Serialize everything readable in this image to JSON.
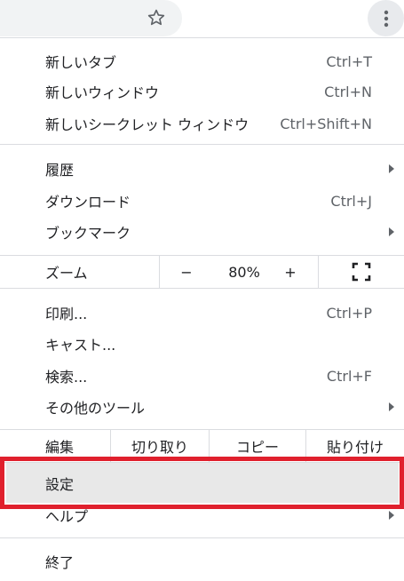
{
  "toolbar": {
    "star_icon": "star-outline-icon",
    "menu_icon": "three-dots-vertical-icon"
  },
  "menu": {
    "new_tab": {
      "label": "新しいタブ",
      "shortcut": "Ctrl+T"
    },
    "new_window": {
      "label": "新しいウィンドウ",
      "shortcut": "Ctrl+N"
    },
    "new_incognito": {
      "label": "新しいシークレット ウィンドウ",
      "shortcut": "Ctrl+Shift+N"
    },
    "history": {
      "label": "履歴"
    },
    "downloads": {
      "label": "ダウンロード",
      "shortcut": "Ctrl+J"
    },
    "bookmarks": {
      "label": "ブックマーク"
    },
    "zoom": {
      "label": "ズーム",
      "minus": "−",
      "value": "80%",
      "plus": "+",
      "fullscreen_icon": "fullscreen-icon"
    },
    "print": {
      "label": "印刷...",
      "shortcut": "Ctrl+P"
    },
    "cast": {
      "label": "キャスト..."
    },
    "find": {
      "label": "検索...",
      "shortcut": "Ctrl+F"
    },
    "more_tools": {
      "label": "その他のツール"
    },
    "edit": {
      "label": "編集",
      "cut": "切り取り",
      "copy": "コピー",
      "paste": "貼り付け"
    },
    "settings": {
      "label": "設定"
    },
    "help": {
      "label": "ヘルプ"
    },
    "exit": {
      "label": "終了"
    }
  },
  "colors": {
    "highlight_border": "#e0202d",
    "hover_bg": "#e8e8e8",
    "separator": "#dadce0"
  }
}
